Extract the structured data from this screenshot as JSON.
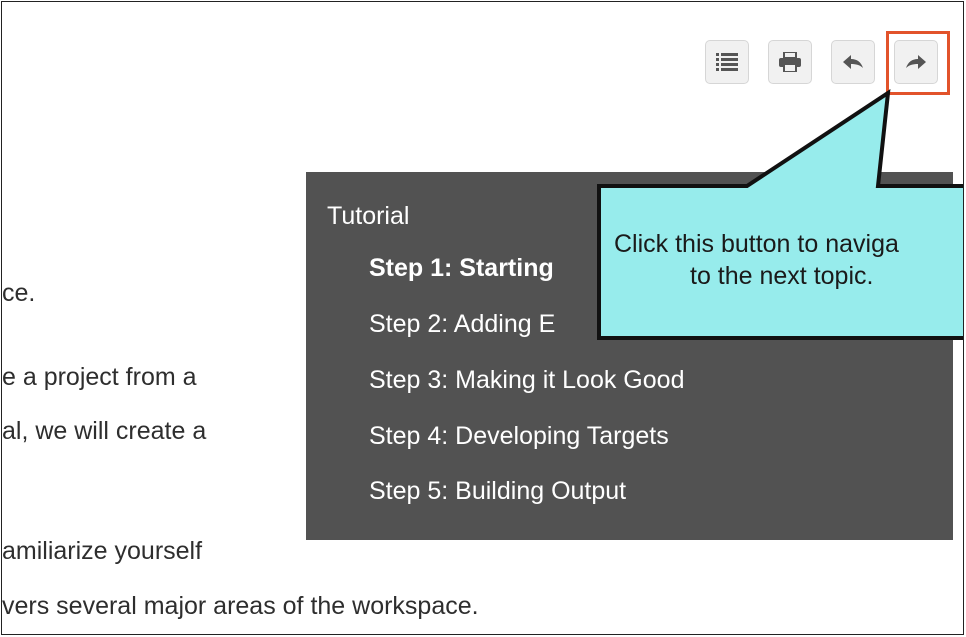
{
  "toolbar": {
    "buttons": [
      {
        "name": "toc-button",
        "icon": "list-icon"
      },
      {
        "name": "print-button",
        "icon": "printer-icon"
      },
      {
        "name": "previous-topic-button",
        "icon": "arrow-left-icon"
      },
      {
        "name": "next-topic-button",
        "icon": "arrow-right-icon"
      }
    ],
    "highlight_color": "#e2532b"
  },
  "body": {
    "lines": [
      "ce.",
      "e a project from a",
      "al, we will create a",
      "amiliarize yourself",
      "vers several major areas of the workspace."
    ]
  },
  "toc": {
    "title": "Tutorial",
    "items": [
      {
        "label": "Step 1: Starting",
        "current": true
      },
      {
        "label": "Step 2: Adding E",
        "current": false
      },
      {
        "label": "Step 3: Making it Look Good",
        "current": false
      },
      {
        "label": "Step 4: Developing Targets",
        "current": false
      },
      {
        "label": "Step 5: Building Output",
        "current": false
      }
    ],
    "background": "#525252"
  },
  "callout": {
    "line1": "Click this button to naviga",
    "line2": "to the next topic.",
    "fill": "#97ecec"
  }
}
